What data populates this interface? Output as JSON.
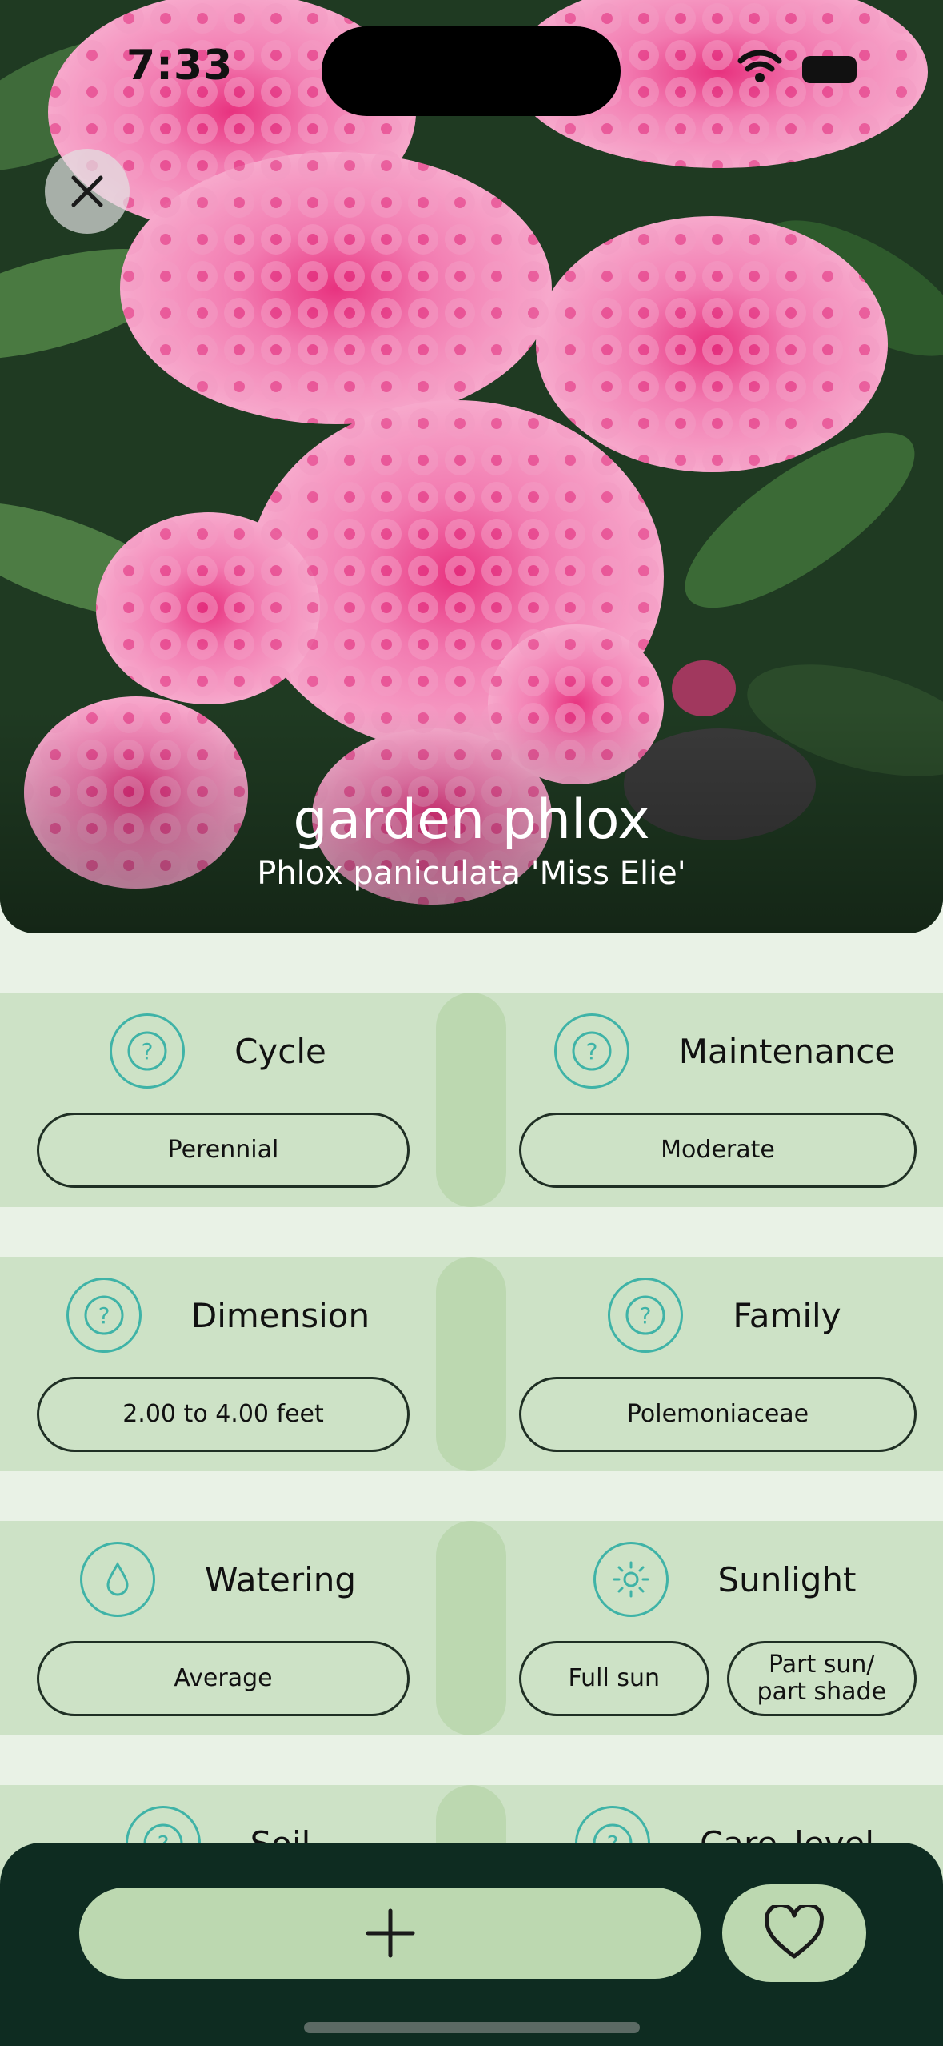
{
  "status_bar": {
    "time": "7:33"
  },
  "hero": {
    "common_name": "garden phlox",
    "scientific_name": "Phlox paniculata 'Miss Elie'"
  },
  "rows": [
    {
      "left": {
        "title": "Cycle",
        "icon": "question-icon",
        "values": [
          "Perennial"
        ]
      },
      "right": {
        "title": "Maintenance",
        "icon": "question-icon",
        "values": [
          "Moderate"
        ]
      }
    },
    {
      "left": {
        "title": "Dimension",
        "icon": "question-icon",
        "values": [
          "2.00 to 4.00 feet"
        ]
      },
      "right": {
        "title": "Family",
        "icon": "question-icon",
        "values": [
          "Polemoniaceae"
        ]
      }
    },
    {
      "left": {
        "title": "Watering",
        "icon": "water-drop-icon",
        "values": [
          "Average"
        ]
      },
      "right": {
        "title": "Sunlight",
        "icon": "sun-icon",
        "values": [
          "Full sun",
          "Part sun/\npart shade"
        ]
      }
    },
    {
      "left": {
        "title": "Soil",
        "icon": "question-icon",
        "values": []
      },
      "right": {
        "title": "Care_level",
        "icon": "question-icon",
        "values": []
      }
    }
  ],
  "colors": {
    "background": "#e9f2e6",
    "row": "#cde2c6",
    "accent_teal": "#3fb3a7",
    "bottom_bar": "#0e2c21",
    "button": "#bcd8b0"
  }
}
